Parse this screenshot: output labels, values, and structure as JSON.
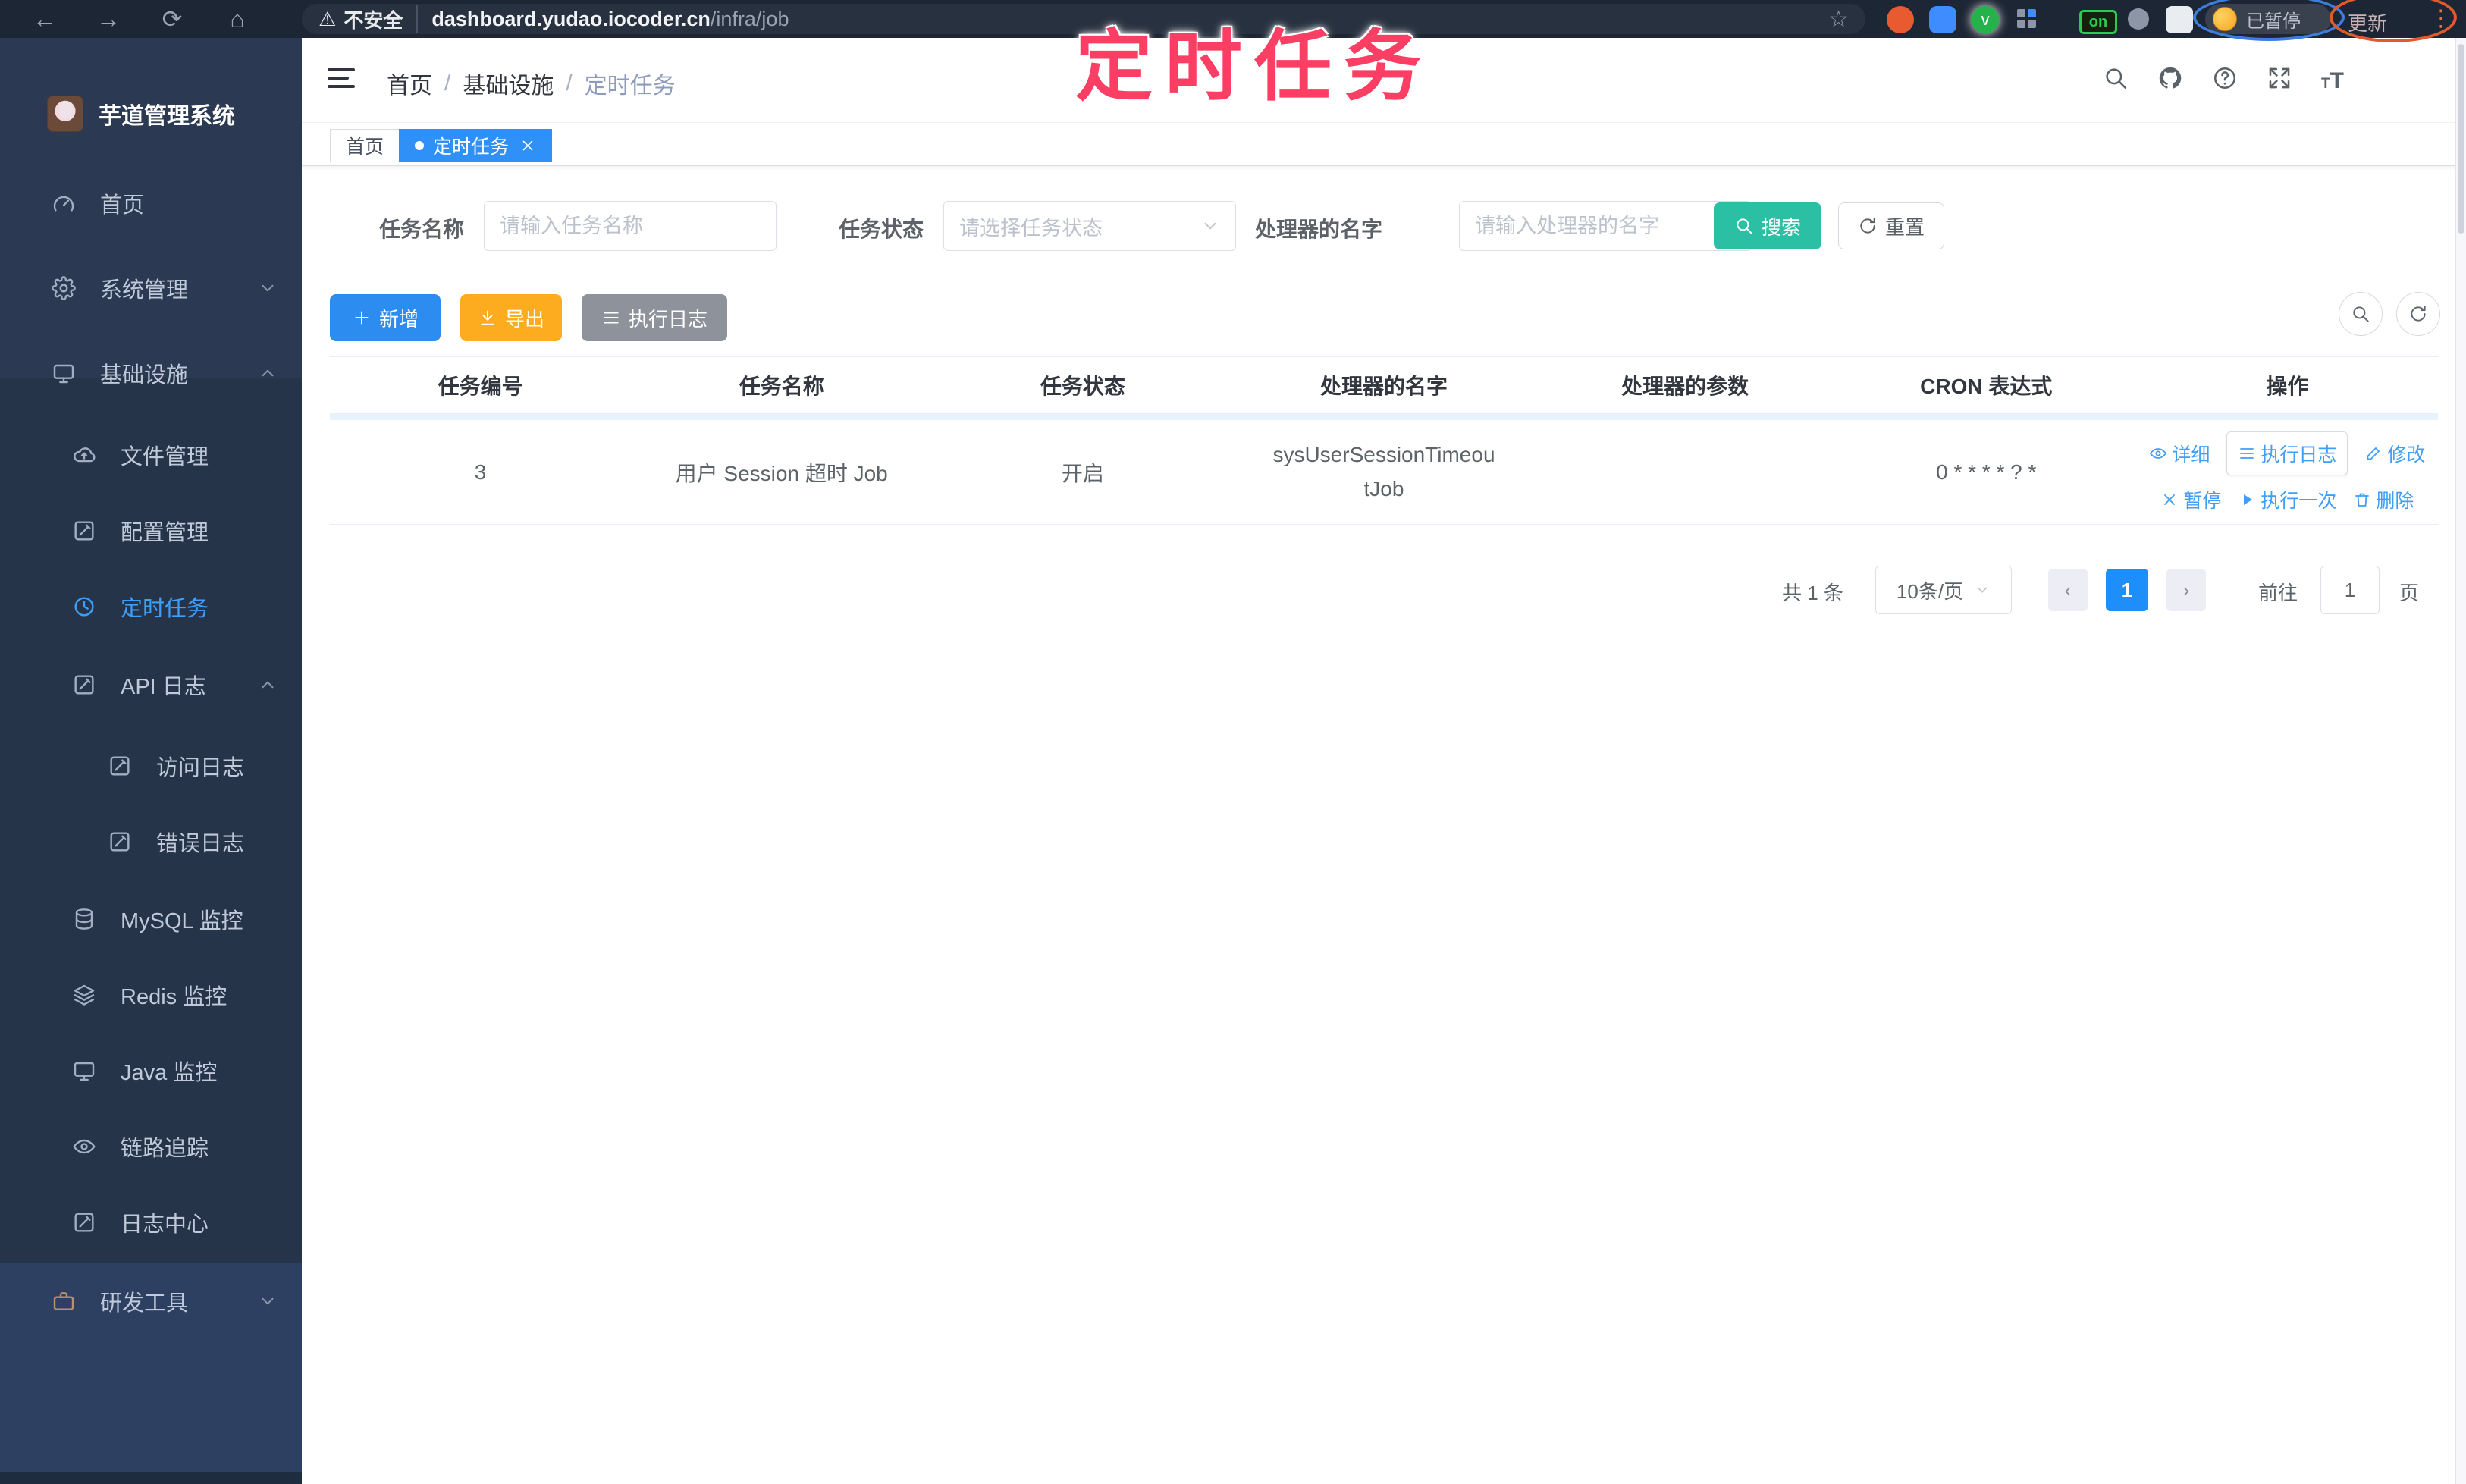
{
  "browser": {
    "security_label": "不安全",
    "url_host": "dashboard.yudao.iocoder.cn",
    "url_path": "/infra/job",
    "extension_on_badge": "on",
    "paused_badge": "已暂停",
    "update_badge": "更新"
  },
  "overlay": {
    "annotation": "定时任务"
  },
  "sidebar": {
    "title": "芋道管理系统",
    "items": [
      {
        "label": "首页",
        "level": 1,
        "active": false
      },
      {
        "label": "系统管理",
        "level": 1,
        "active": false,
        "chevron": "down"
      },
      {
        "label": "基础设施",
        "level": 1,
        "active": false,
        "chevron": "up"
      },
      {
        "label": "文件管理",
        "level": 2,
        "active": false
      },
      {
        "label": "配置管理",
        "level": 2,
        "active": false
      },
      {
        "label": "定时任务",
        "level": 2,
        "active": true
      },
      {
        "label": "API 日志",
        "level": 2,
        "active": false,
        "chevron": "up"
      },
      {
        "label": "访问日志",
        "level": 3,
        "active": false
      },
      {
        "label": "错误日志",
        "level": 3,
        "active": false
      },
      {
        "label": "MySQL 监控",
        "level": 2,
        "active": false
      },
      {
        "label": "Redis 监控",
        "level": 2,
        "active": false
      },
      {
        "label": "Java 监控",
        "level": 2,
        "active": false
      },
      {
        "label": "链路追踪",
        "level": 2,
        "active": false
      },
      {
        "label": "日志中心",
        "level": 2,
        "active": false
      },
      {
        "label": "研发工具",
        "level": 1,
        "active": false,
        "chevron": "down"
      }
    ]
  },
  "navbar": {
    "breadcrumb": [
      "首页",
      "基础设施",
      "定时任务"
    ],
    "breadcrumb_separator": "/"
  },
  "tabs": [
    {
      "label": "首页",
      "active": false
    },
    {
      "label": "定时任务",
      "active": true,
      "closable": true
    }
  ],
  "filters": {
    "name_label": "任务名称",
    "name_placeholder": "请输入任务名称",
    "status_label": "任务状态",
    "status_placeholder": "请选择任务状态",
    "handler_label": "处理器的名字",
    "handler_placeholder": "请输入处理器的名字",
    "search_label": "搜索",
    "reset_label": "重置"
  },
  "toolbar": {
    "add_label": "新增",
    "export_label": "导出",
    "log_label": "执行日志"
  },
  "table": {
    "headers": [
      "任务编号",
      "任务名称",
      "任务状态",
      "处理器的名字",
      "处理器的参数",
      "CRON 表达式",
      "操作"
    ],
    "row": {
      "id": "3",
      "name": "用户 Session 超时 Job",
      "status": "开启",
      "handler": "sysUserSessionTimeoutJob",
      "param": "",
      "cron": "0 * * * * ? *"
    },
    "actions_row1": [
      "详细",
      "执行日志",
      "修改"
    ],
    "actions_row2": [
      "暂停",
      "执行一次",
      "删除"
    ]
  },
  "pagination": {
    "total": "共 1 条",
    "page_size": "10条/页",
    "current_page": "1",
    "goto_label": "前往",
    "goto_value": "1",
    "page_unit": "页"
  },
  "colors": {
    "accent_blue": "#409eff",
    "search_teal": "#2bbfa4",
    "export_orange": "#fdab1f",
    "log_gray": "#8e939b",
    "annotation_pink": "#fb3e63",
    "sidebar_bg": "#2b3a52",
    "browser_bar_bg": "#1d2634"
  }
}
